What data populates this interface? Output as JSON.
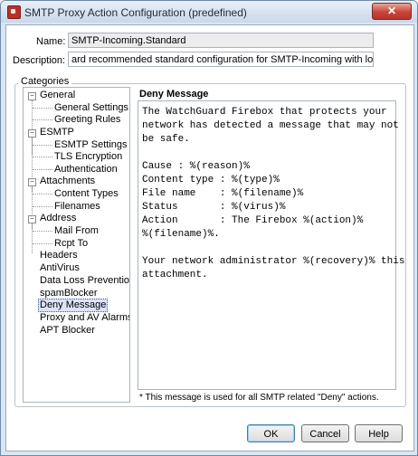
{
  "window": {
    "title": "SMTP Proxy Action Configuration (predefined)",
    "close_glyph": "✕",
    "icon": "watchguard-icon"
  },
  "form": {
    "name_label": "Name:",
    "name_value": "SMTP-Incoming.Standard",
    "description_label": "Description:",
    "description_value": "ard recommended standard configuration for SMTP-Incoming with logging enabled"
  },
  "categories": {
    "title": "Categories",
    "items": [
      {
        "label": "General",
        "expanded": true
      },
      {
        "label": "General Settings"
      },
      {
        "label": "Greeting Rules"
      },
      {
        "label": "ESMTP",
        "expanded": true
      },
      {
        "label": "ESMTP Settings"
      },
      {
        "label": "TLS Encryption"
      },
      {
        "label": "Authentication"
      },
      {
        "label": "Attachments",
        "expanded": true
      },
      {
        "label": "Content Types"
      },
      {
        "label": "Filenames"
      },
      {
        "label": "Address",
        "expanded": true
      },
      {
        "label": "Mail From"
      },
      {
        "label": "Rcpt To"
      },
      {
        "label": "Headers"
      },
      {
        "label": "AntiVirus"
      },
      {
        "label": "Data Loss Prevention"
      },
      {
        "label": "spamBlocker"
      },
      {
        "label": "Deny Message",
        "selected": true
      },
      {
        "label": "Proxy and AV Alarms"
      },
      {
        "label": "APT Blocker"
      }
    ]
  },
  "deny": {
    "title": "Deny Message",
    "message": "The WatchGuard Firebox that protects your\nnetwork has detected a message that may not\nbe safe.\n\nCause : %(reason)%\nContent type : %(type)%\nFile name    : %(filename)%\nStatus       : %(virus)%\nAction       : The Firebox %(action)%\n%(filename)%.\n\nYour network administrator %(recovery)% this\nattachment.",
    "note": "* This message is used for all SMTP related \"Deny\" actions."
  },
  "buttons": {
    "ok": "OK",
    "cancel": "Cancel",
    "help": "Help"
  }
}
